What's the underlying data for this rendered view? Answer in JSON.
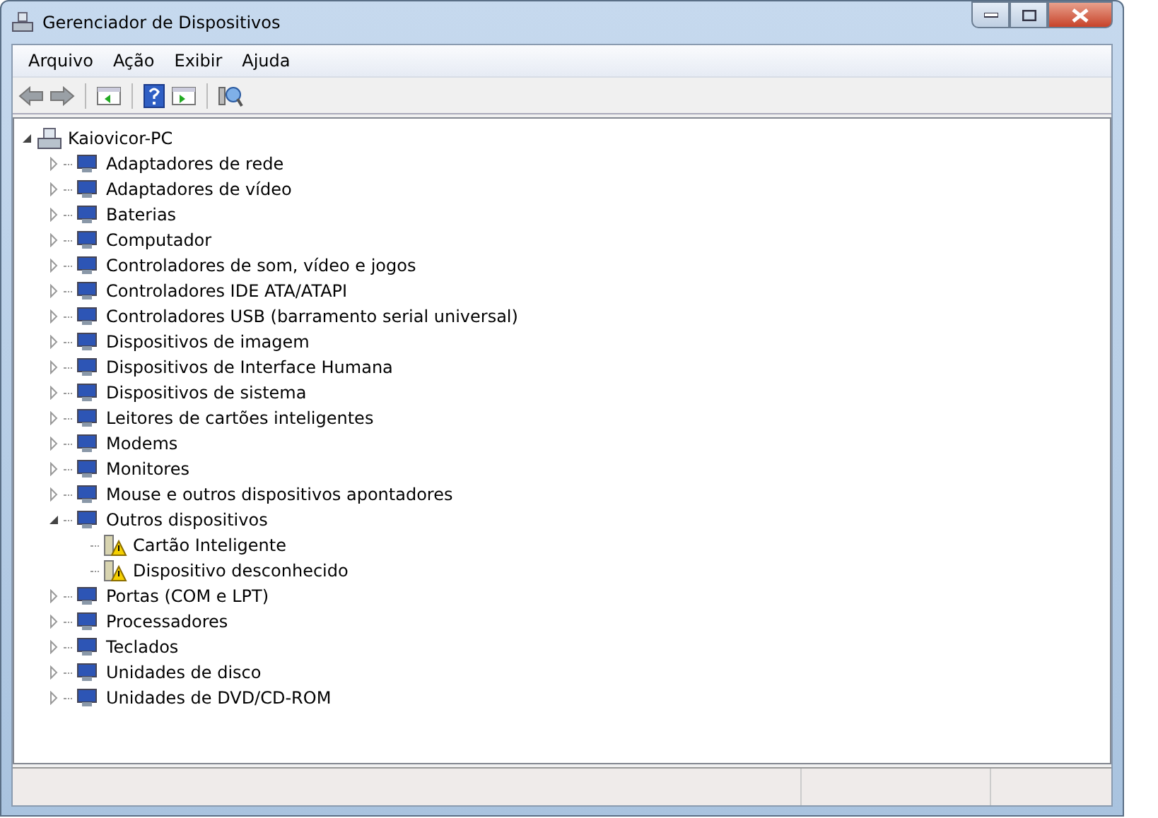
{
  "window": {
    "title": "Gerenciador de Dispositivos"
  },
  "menu": [
    "Arquivo",
    "Ação",
    "Exibir",
    "Ajuda"
  ],
  "tree": {
    "label": "Kaiovicor-PC",
    "expanded": true,
    "children": [
      {
        "label": "Adaptadores de rede",
        "expanded": false
      },
      {
        "label": "Adaptadores de vídeo",
        "expanded": false
      },
      {
        "label": "Baterias",
        "expanded": false
      },
      {
        "label": "Computador",
        "expanded": false
      },
      {
        "label": "Controladores de som, vídeo e jogos",
        "expanded": false
      },
      {
        "label": "Controladores IDE ATA/ATAPI",
        "expanded": false
      },
      {
        "label": "Controladores USB (barramento serial universal)",
        "expanded": false
      },
      {
        "label": "Dispositivos de imagem",
        "expanded": false
      },
      {
        "label": "Dispositivos de Interface Humana",
        "expanded": false
      },
      {
        "label": "Dispositivos de sistema",
        "expanded": false
      },
      {
        "label": "Leitores de cartões inteligentes",
        "expanded": false
      },
      {
        "label": "Modems",
        "expanded": false
      },
      {
        "label": "Monitores",
        "expanded": false
      },
      {
        "label": "Mouse e outros dispositivos apontadores",
        "expanded": false
      },
      {
        "label": "Outros dispositivos",
        "expanded": true,
        "children": [
          {
            "label": "Cartão Inteligente",
            "warning": true
          },
          {
            "label": "Dispositivo desconhecido",
            "warning": true
          }
        ]
      },
      {
        "label": "Portas (COM e LPT)",
        "expanded": false
      },
      {
        "label": "Processadores",
        "expanded": false
      },
      {
        "label": "Teclados",
        "expanded": false
      },
      {
        "label": "Unidades de disco",
        "expanded": false
      },
      {
        "label": "Unidades de DVD/CD-ROM",
        "expanded": false
      }
    ]
  }
}
